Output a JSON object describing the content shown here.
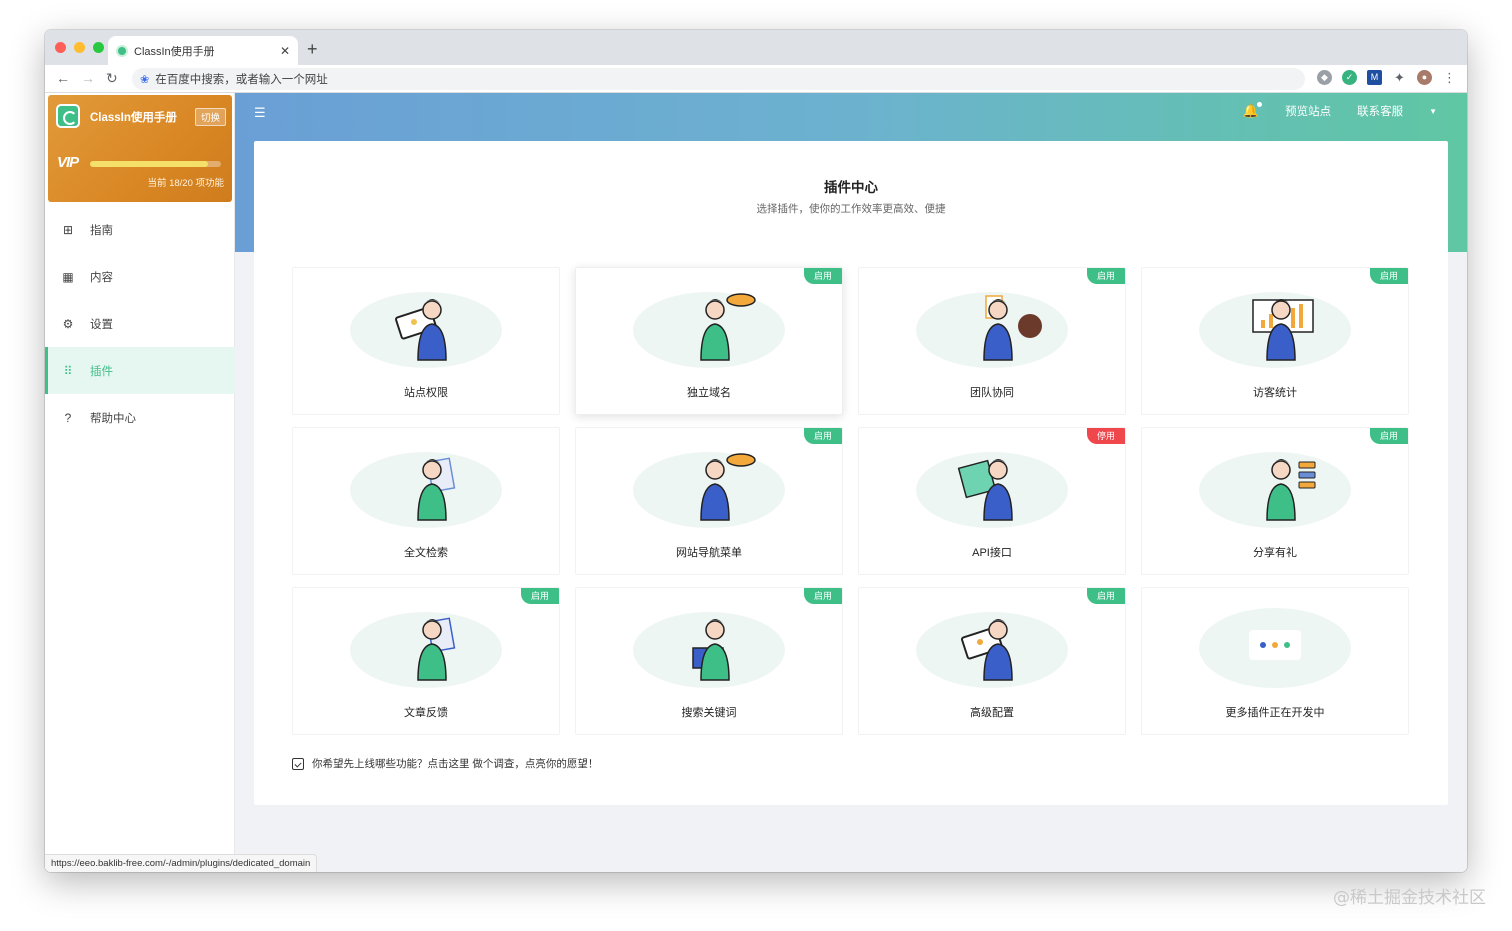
{
  "browser": {
    "tab_title": "ClassIn使用手册",
    "address_placeholder": "在百度中搜索，或者输入一个网址",
    "status_url": "https://eeo.baklib-free.com/-/admin/plugins/dedicated_domain",
    "extension_icons": [
      "shield-extension-icon",
      "green-v-extension-icon",
      "m-extension-icon",
      "puzzle-icon",
      "profile-avatar",
      "more-vert-icon"
    ]
  },
  "site": {
    "name": "ClassIn使用手册",
    "switch_label": "切换",
    "vip_mark": "VIP",
    "vip_progress": 0.9,
    "vip_count": "当前 18/20 项功能"
  },
  "sidebar": {
    "items": [
      {
        "label": "指南",
        "icon": "signpost-icon",
        "active": false
      },
      {
        "label": "内容",
        "icon": "grid-icon",
        "active": false
      },
      {
        "label": "设置",
        "icon": "gear-icon",
        "active": false
      },
      {
        "label": "插件",
        "icon": "apps-icon",
        "active": true
      },
      {
        "label": "帮助中心",
        "icon": "help-icon",
        "active": false
      }
    ]
  },
  "header": {
    "preview": "预览站点",
    "contact": "联系客服"
  },
  "plugins": {
    "title": "插件中心",
    "subtitle": "选择插件，使你的工作效率更高效、便捷",
    "cards": [
      {
        "label": "站点权限",
        "badge": ""
      },
      {
        "label": "独立域名",
        "badge": "启用"
      },
      {
        "label": "团队协同",
        "badge": "启用"
      },
      {
        "label": "访客统计",
        "badge": "启用"
      },
      {
        "label": "全文检索",
        "badge": ""
      },
      {
        "label": "网站导航菜单",
        "badge": "启用"
      },
      {
        "label": "API接口",
        "badge": "停用"
      },
      {
        "label": "分享有礼",
        "badge": "启用"
      },
      {
        "label": "文章反馈",
        "badge": "启用"
      },
      {
        "label": "搜索关键词",
        "badge": "启用"
      },
      {
        "label": "高级配置",
        "badge": "启用"
      },
      {
        "label": "更多插件正在开发中",
        "badge": ""
      }
    ],
    "survey": "你希望先上线哪些功能？点击这里 做个调查，点亮你的愿望！"
  },
  "watermark": "@稀土掘金技术社区",
  "colors": {
    "accent": "#3fbf88",
    "stop": "#f0474c",
    "vip": "#d98724",
    "hero_start": "#6a9fd6",
    "hero_end": "#5fc7a3"
  }
}
